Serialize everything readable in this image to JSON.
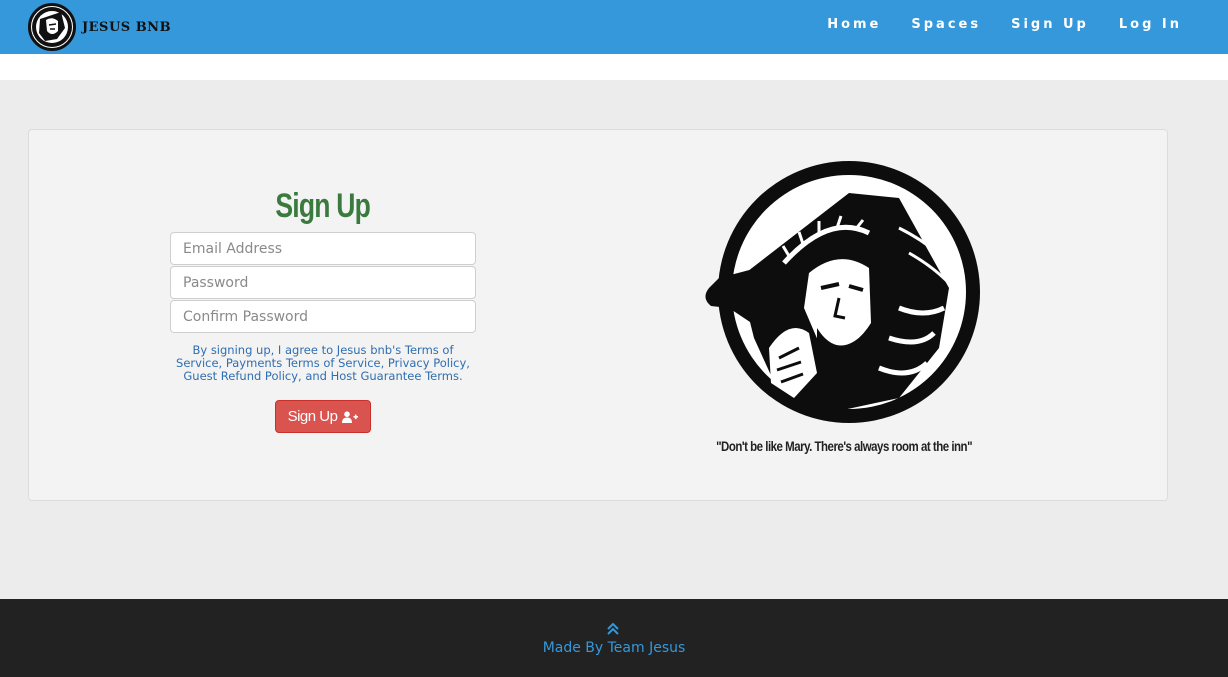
{
  "brand": {
    "name": "JESUS BNB",
    "logo_icon": "jesus-portrait-icon"
  },
  "nav": {
    "items": [
      {
        "label": "Home"
      },
      {
        "label": "Spaces"
      },
      {
        "label": "Sign Up"
      },
      {
        "label": "Log In"
      }
    ]
  },
  "form": {
    "title": "Sign Up",
    "email_placeholder": "Email Address",
    "password_placeholder": "Password",
    "confirm_placeholder": "Confirm Password",
    "terms_text": "By signing up, I agree to Jesus bnb's Terms of Service, Payments Terms of Service, Privacy Policy, Guest Refund Policy, and Host Guarantee Terms.",
    "submit_label": "Sign Up",
    "submit_icon": "user-plus-icon"
  },
  "hero": {
    "image_icon": "jesus-portrait-icon",
    "quote": "\"Don't be like Mary. There's always room at the inn\""
  },
  "footer": {
    "up_icon": "double-chevron-up-icon",
    "text": "Made By Team Jesus"
  },
  "colors": {
    "navbar": "#3498db",
    "title_green": "#3a7a3e",
    "button_red": "#d9534f",
    "link_blue": "#2f6eb0",
    "footer_bg": "#222222"
  }
}
